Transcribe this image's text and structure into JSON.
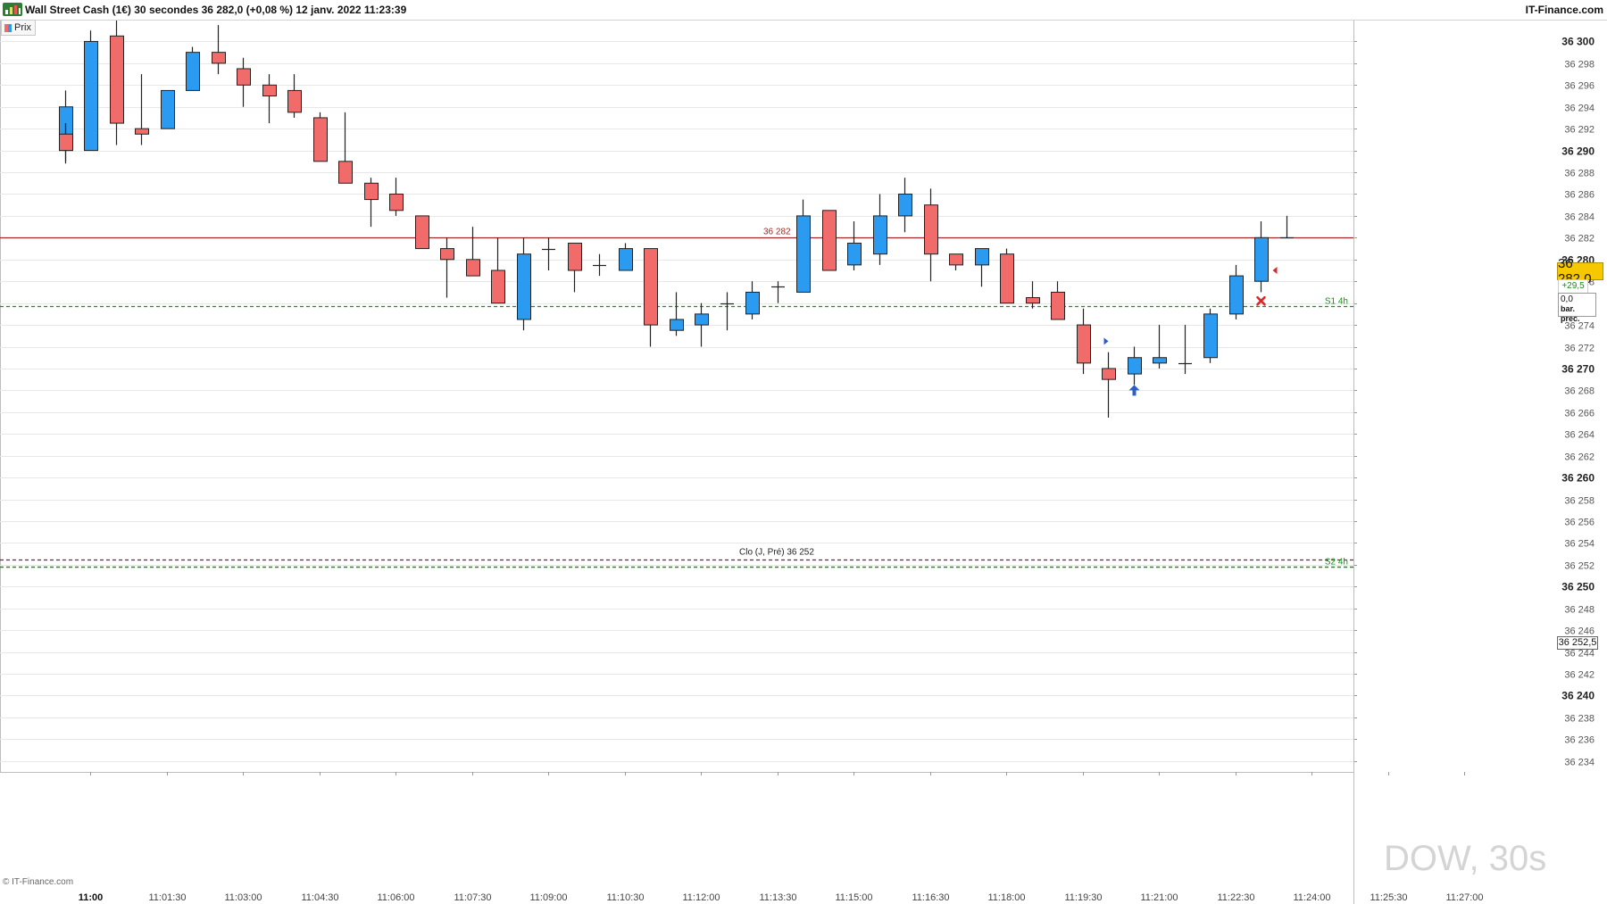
{
  "header": {
    "title": "Wall Street Cash (1€) 30 secondes 36 282,0 (+0,08 %) 12 janv. 2022 11:23:39",
    "brand": "IT-Finance.com"
  },
  "legend": {
    "label": "Prix"
  },
  "footer": {
    "copyright": "© IT-Finance.com"
  },
  "watermark": "DOW, 30s",
  "price_panel": {
    "current": "36 282,0",
    "change": "+29,5",
    "prev_value": "0,0",
    "prev_label": "bar. prec.",
    "clo_value": "36 252,5"
  },
  "colors": {
    "up": "#2a9bf0",
    "down": "#f26b6b",
    "current_line": "#a02828",
    "support_line": "#1f8f1f",
    "clo_line": "#7a1f3f",
    "price_box": "#f6c800"
  },
  "chart_data": {
    "type": "candlestick",
    "title": "Wall Street Cash (1€) 30 secondes",
    "y_range": [
      36233,
      36302
    ],
    "y_ticks": [
      36234,
      36236,
      36238,
      36240,
      36242,
      36244,
      36246,
      36248,
      36250,
      36252,
      36254,
      36256,
      36258,
      36260,
      36262,
      36264,
      36266,
      36268,
      36270,
      36272,
      36274,
      36276,
      36278,
      36280,
      36282,
      36284,
      36286,
      36288,
      36290,
      36292,
      36294,
      36296,
      36298,
      36300
    ],
    "y_tick_labels": [
      "36 234",
      "36 236",
      "36 238",
      "36 240",
      "36 242",
      "36 244",
      "36 246",
      "36 248",
      "36 250",
      "36 252",
      "36 254",
      "36 256",
      "36 258",
      "36 260",
      "36 262",
      "36 264",
      "36 266",
      "36 268",
      "36 270",
      "36 272",
      "36 274",
      "36 276",
      "36 278",
      "36 280",
      "36 282",
      "36 284",
      "36 286",
      "36 288",
      "36 290",
      "36 292",
      "36 294",
      "36 296",
      "36 298",
      "36 300"
    ],
    "y_major_ticks": [
      36240,
      36250,
      36260,
      36270,
      36280,
      36290,
      36300
    ],
    "x_tick_labels": [
      "11:00",
      "11:01:30",
      "11:03:00",
      "11:04:30",
      "11:06:00",
      "11:07:30",
      "11:09:00",
      "11:10:30",
      "11:12:00",
      "11:13:30",
      "11:15:00",
      "11:16:30",
      "11:18:00",
      "11:19:30",
      "11:21:00",
      "11:22:30",
      "11:24:00",
      "11:25:30",
      "11:27:00"
    ],
    "x_major_label": "11:00",
    "candles": [
      {
        "t": "10:59:30",
        "o": 36290.0,
        "h": 36295.5,
        "l": 36288.8,
        "c": 36294.0
      },
      {
        "t": "10:59:30",
        "o": 36291.0,
        "h": 36292.5,
        "l": 36290.0,
        "c": 36290.5
      },
      {
        "t": "10:59:30",
        "o": 36291.5,
        "h": 36292.5,
        "l": 36289.0,
        "c": 36290.0
      },
      {
        "t": "11:00:00",
        "o": 36290.0,
        "h": 36301.0,
        "l": 36290.0,
        "c": 36300.0
      },
      {
        "t": "11:00:30",
        "o": 36300.5,
        "h": 36302.0,
        "l": 36290.5,
        "c": 36292.5
      },
      {
        "t": "11:01:00",
        "o": 36292.0,
        "h": 36297.0,
        "l": 36290.5,
        "c": 36291.5
      },
      {
        "t": "11:01:30",
        "o": 36292.0,
        "h": 36295.5,
        "l": 36292.0,
        "c": 36295.5
      },
      {
        "t": "11:02:00",
        "o": 36295.5,
        "h": 36299.5,
        "l": 36295.5,
        "c": 36299.0
      },
      {
        "t": "11:02:30",
        "o": 36299.0,
        "h": 36301.5,
        "l": 36297.0,
        "c": 36298.0
      },
      {
        "t": "11:03:00",
        "o": 36297.5,
        "h": 36298.5,
        "l": 36294.0,
        "c": 36296.0
      },
      {
        "t": "11:03:30",
        "o": 36296.0,
        "h": 36297.0,
        "l": 36292.5,
        "c": 36295.0
      },
      {
        "t": "11:04:00",
        "o": 36295.5,
        "h": 36297.0,
        "l": 36293.0,
        "c": 36293.5
      },
      {
        "t": "11:04:30",
        "o": 36293.0,
        "h": 36293.5,
        "l": 36289.0,
        "c": 36289.0
      },
      {
        "t": "11:05:00",
        "o": 36289.0,
        "h": 36293.5,
        "l": 36287.0,
        "c": 36287.0
      },
      {
        "t": "11:05:30",
        "o": 36287.0,
        "h": 36287.5,
        "l": 36283.0,
        "c": 36285.5
      },
      {
        "t": "11:06:00",
        "o": 36286.0,
        "h": 36287.5,
        "l": 36284.0,
        "c": 36284.5
      },
      {
        "t": "11:06:30",
        "o": 36284.0,
        "h": 36284.0,
        "l": 36281.0,
        "c": 36281.0
      },
      {
        "t": "11:07:00",
        "o": 36281.0,
        "h": 36282.0,
        "l": 36276.5,
        "c": 36280.0
      },
      {
        "t": "11:07:30",
        "o": 36280.0,
        "h": 36283.0,
        "l": 36278.5,
        "c": 36278.5
      },
      {
        "t": "11:08:00",
        "o": 36279.0,
        "h": 36282.0,
        "l": 36276.0,
        "c": 36276.0
      },
      {
        "t": "11:08:30",
        "o": 36274.5,
        "h": 36282.0,
        "l": 36273.5,
        "c": 36280.5
      },
      {
        "t": "11:09:00",
        "o": 36281.0,
        "h": 36282.0,
        "l": 36279.0,
        "c": 36281.0
      },
      {
        "t": "11:09:30",
        "o": 36281.5,
        "h": 36281.5,
        "l": 36277.0,
        "c": 36279.0
      },
      {
        "t": "11:10:00",
        "o": 36279.5,
        "h": 36280.5,
        "l": 36278.5,
        "c": 36279.5
      },
      {
        "t": "11:10:30",
        "o": 36279.0,
        "h": 36281.5,
        "l": 36279.0,
        "c": 36281.0
      },
      {
        "t": "11:11:00",
        "o": 36281.0,
        "h": 36281.0,
        "l": 36272.0,
        "c": 36274.0
      },
      {
        "t": "11:11:30",
        "o": 36273.5,
        "h": 36277.0,
        "l": 36273.0,
        "c": 36274.5
      },
      {
        "t": "11:12:00",
        "o": 36274.0,
        "h": 36276.0,
        "l": 36272.0,
        "c": 36275.0
      },
      {
        "t": "11:12:30",
        "o": 36276.0,
        "h": 36277.0,
        "l": 36273.5,
        "c": 36276.0
      },
      {
        "t": "11:13:00",
        "o": 36275.0,
        "h": 36278.0,
        "l": 36274.5,
        "c": 36277.0
      },
      {
        "t": "11:13:30",
        "o": 36277.5,
        "h": 36278.0,
        "l": 36276.0,
        "c": 36277.5
      },
      {
        "t": "11:14:00",
        "o": 36277.0,
        "h": 36285.5,
        "l": 36277.0,
        "c": 36284.0
      },
      {
        "t": "11:14:30",
        "o": 36284.5,
        "h": 36284.5,
        "l": 36279.0,
        "c": 36279.0
      },
      {
        "t": "11:15:00",
        "o": 36279.5,
        "h": 36283.5,
        "l": 36279.0,
        "c": 36281.5
      },
      {
        "t": "11:15:30",
        "o": 36280.5,
        "h": 36286.0,
        "l": 36279.5,
        "c": 36284.0
      },
      {
        "t": "11:16:00",
        "o": 36284.0,
        "h": 36287.5,
        "l": 36282.5,
        "c": 36286.0
      },
      {
        "t": "11:16:30",
        "o": 36285.0,
        "h": 36286.5,
        "l": 36278.0,
        "c": 36280.5
      },
      {
        "t": "11:17:00",
        "o": 36280.5,
        "h": 36280.5,
        "l": 36279.0,
        "c": 36279.5
      },
      {
        "t": "11:17:30",
        "o": 36279.5,
        "h": 36281.0,
        "l": 36277.5,
        "c": 36281.0
      },
      {
        "t": "11:18:00",
        "o": 36280.5,
        "h": 36281.0,
        "l": 36276.0,
        "c": 36276.0
      },
      {
        "t": "11:18:30",
        "o": 36276.5,
        "h": 36278.0,
        "l": 36275.5,
        "c": 36276.0
      },
      {
        "t": "11:19:00",
        "o": 36277.0,
        "h": 36278.0,
        "l": 36274.5,
        "c": 36274.5
      },
      {
        "t": "11:19:30",
        "o": 36274.0,
        "h": 36275.5,
        "l": 36269.5,
        "c": 36270.5
      },
      {
        "t": "11:20:00",
        "o": 36270.0,
        "h": 36271.5,
        "l": 36265.5,
        "c": 36269.0
      },
      {
        "t": "11:20:30",
        "o": 36269.5,
        "h": 36272.0,
        "l": 36268.5,
        "c": 36271.0
      },
      {
        "t": "11:21:00",
        "o": 36270.5,
        "h": 36274.0,
        "l": 36270.0,
        "c": 36271.0
      },
      {
        "t": "11:21:30",
        "o": 36270.5,
        "h": 36274.0,
        "l": 36269.5,
        "c": 36270.5
      },
      {
        "t": "11:22:00",
        "o": 36271.0,
        "h": 36275.5,
        "l": 36270.5,
        "c": 36275.0
      },
      {
        "t": "11:22:30",
        "o": 36275.0,
        "h": 36279.5,
        "l": 36274.5,
        "c": 36278.5
      },
      {
        "t": "11:23:00",
        "o": 36278.0,
        "h": 36283.5,
        "l": 36277.0,
        "c": 36282.0
      },
      {
        "t": "11:23:30",
        "o": 36282.0,
        "h": 36284.0,
        "l": 36282.0,
        "c": 36282.0
      }
    ],
    "levels": [
      {
        "name": "current",
        "value": 36282.0,
        "label": "36 282",
        "style": "solid"
      },
      {
        "name": "s1",
        "value": 36275.7,
        "label": "S1 4h",
        "style": "dashed"
      },
      {
        "name": "clo",
        "value": 36252.5,
        "label": "Clo (J, Pré) 36 252",
        "style": "dashed"
      },
      {
        "name": "s2",
        "value": 36251.8,
        "label": "S2 4h",
        "style": "dashed"
      }
    ],
    "markers": [
      {
        "kind": "triangle-right",
        "t": "11:20:00",
        "v": 36272.5,
        "color": "#2a5ec9"
      },
      {
        "kind": "arrow-up",
        "t": "11:20:30",
        "v": 36268.0,
        "color": "#2a5ec9"
      },
      {
        "kind": "triangle-left",
        "t": "11:23:00",
        "v": 36279.0,
        "color": "#d62a2a"
      },
      {
        "kind": "cross",
        "t": "11:23:00",
        "v": 36276.2,
        "color": "#d62a2a"
      }
    ]
  }
}
